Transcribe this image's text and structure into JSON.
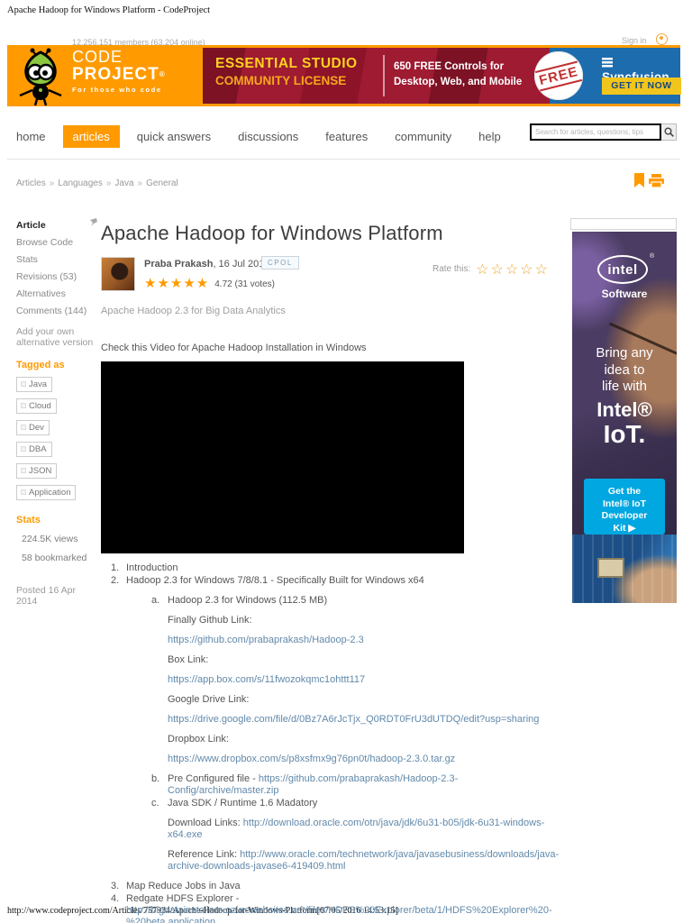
{
  "print": {
    "header": "Apache Hadoop for Windows Platform - CodeProject",
    "footer": "http://www.codeproject.com/Articles/757934/Apache-Hadoop-for-Windows-Platform[07/05/2016 14:53:15]"
  },
  "header": {
    "members": "12,256,151 members (63,204 online)",
    "sign_in": "Sign in",
    "logo": {
      "top": "CODE",
      "bottom": "PROJECT",
      "reg": "®",
      "tagline": "For those who code"
    },
    "banner": {
      "line1": "ESSENTIAL STUDIO",
      "line2": "COMMUNITY LICENSE",
      "sub1": "650 FREE Controls for",
      "sub2": "Desktop, Web, and Mobile",
      "stamp": "FREE",
      "brand": "Syncfusion",
      "cta": "GET IT NOW"
    }
  },
  "nav": {
    "items": [
      {
        "label": "home"
      },
      {
        "label": "articles"
      },
      {
        "label": "quick answers"
      },
      {
        "label": "discussions"
      },
      {
        "label": "features"
      },
      {
        "label": "community"
      },
      {
        "label": "help"
      }
    ],
    "search_placeholder": "Search for articles, questions, tips",
    "search_icon": "⌕"
  },
  "breadcrumb": {
    "sep": "»",
    "items": [
      "Articles",
      "Languages",
      "Java",
      "General"
    ]
  },
  "sidebar": {
    "menu": [
      "Article",
      "Browse Code",
      "Stats",
      "Revisions (53)",
      "Alternatives",
      "Comments (144)"
    ],
    "alt_version": "Add your own alternative version",
    "tagged_heading": "Tagged as",
    "tags": [
      "Java",
      "Cloud",
      "Dev",
      "DBA",
      "JSON",
      "Application"
    ],
    "stats_heading": "Stats",
    "views": "224.5K views",
    "bookmarked": "58 bookmarked",
    "posted": "Posted 16 Apr 2014"
  },
  "article": {
    "title": "Apache Hadoop for Windows Platform",
    "author": "Praba Prakash",
    "date": ", 16 Jul 2014",
    "license": "CPOL",
    "stars_filled": "★★★★★",
    "rating": "4.72 (31 votes)",
    "rate_label": "Rate this:",
    "stars_empty": "☆☆☆☆☆",
    "subtitle": "Apache Hadoop 2.3 for Big Data Analytics",
    "video_caption": "Check this Video for Apache Hadoop Installation in Windows"
  },
  "content": {
    "list": [
      {
        "marker": "1.",
        "text": "Introduction"
      },
      {
        "marker": "2.",
        "text": "Hadoop 2.3 for Windows 7/8/8.1 - Specifically Built for Windows x64"
      },
      {
        "marker": "a.",
        "text": "Hadoop 2.3 for Windows (112.5 MB)"
      },
      {
        "text": "Finally Github Link:"
      },
      {
        "link": "https://github.com/prabaprakash/Hadoop-2.3"
      },
      {
        "text": "Box Link:"
      },
      {
        "link": "https://app.box.com/s/11fwozokqmc1ohttt117"
      },
      {
        "text": "Google Drive Link:"
      },
      {
        "link": "https://drive.google.com/file/d/0Bz7A6rJcTjx_Q0RDT0FrU3dUTDQ/edit?usp=sharing"
      },
      {
        "text": "Dropbox Link:"
      },
      {
        "link": "https://www.dropbox.com/s/p8xsfmx9g76pn0t/hadoop-2.3.0.tar.gz"
      },
      {
        "marker": "b.",
        "text": "Pre Configured file - ",
        "link": "https://github.com/prabaprakash/Hadoop-2.3-Config/archive/master.zip"
      },
      {
        "marker": "c.",
        "text": "Java SDK / Runtime 1.6 Madatory"
      },
      {
        "text": "Download Links: ",
        "link": "http://download.oracle.com/otn/java/jdk/6u31-b05/jdk-6u31-windows-x64.exe"
      },
      {
        "text": "Reference Link: ",
        "link": "http://www.oracle.com/technetwork/java/javasebusiness/downloads/java-archive-downloads-javase6-419409.html"
      },
      {
        "marker": "3.",
        "text": "Map Reduce Jobs in Java"
      },
      {
        "marker": "4.",
        "text": "Redgate HDFS Explorer - ",
        "link": "http://bigdatainstallers.azurewebsites.net/files/HDFS%20Explorer/beta/1/HDFS%20Explorer%20-%20beta.application"
      }
    ]
  },
  "ad": {
    "brand": "intel",
    "reg": "®",
    "software": "Software",
    "tag1": "Bring any",
    "tag2": "idea to",
    "tag3": "life with",
    "big1": "Intel®",
    "big2": "IoT.",
    "cta1": "Get the",
    "cta2": "Intel® IoT",
    "cta3": "Developer",
    "cta4": "Kit ▶"
  }
}
